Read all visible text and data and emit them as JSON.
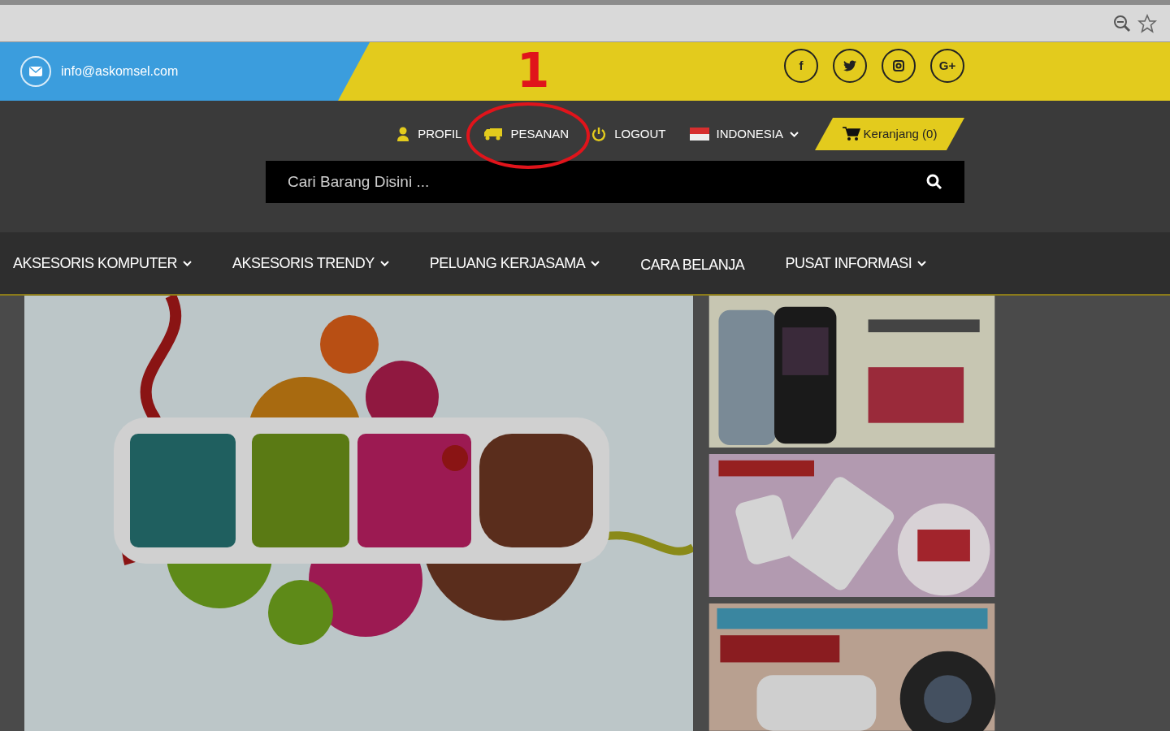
{
  "contact": {
    "email": "info@askomsel.com"
  },
  "social": [
    {
      "kind": "text",
      "label": "f"
    },
    {
      "kind": "bird"
    },
    {
      "kind": "camera"
    },
    {
      "kind": "text",
      "label": "G+"
    }
  ],
  "annotation": {
    "label": "1"
  },
  "account_links": [
    {
      "kind": "user",
      "label": "PROFIL"
    },
    {
      "kind": "truck",
      "label": "PESANAN"
    },
    {
      "kind": "power",
      "label": "LOGOUT"
    }
  ],
  "language": {
    "label": "INDONESIA"
  },
  "cart": {
    "label": "Keranjang (0)"
  },
  "search": {
    "placeholder": "Cari Barang Disini ..."
  },
  "menu": [
    {
      "label": "AKSESORIS KOMPUTER",
      "dropdown": true
    },
    {
      "label": "AKSESORIS TRENDY",
      "dropdown": true
    },
    {
      "label": "PELUANG KERJASAMA",
      "dropdown": true
    },
    {
      "label": "CARA BELANJA",
      "dropdown": false
    },
    {
      "label": "PUSAT INFORMASI",
      "dropdown": true
    }
  ]
}
